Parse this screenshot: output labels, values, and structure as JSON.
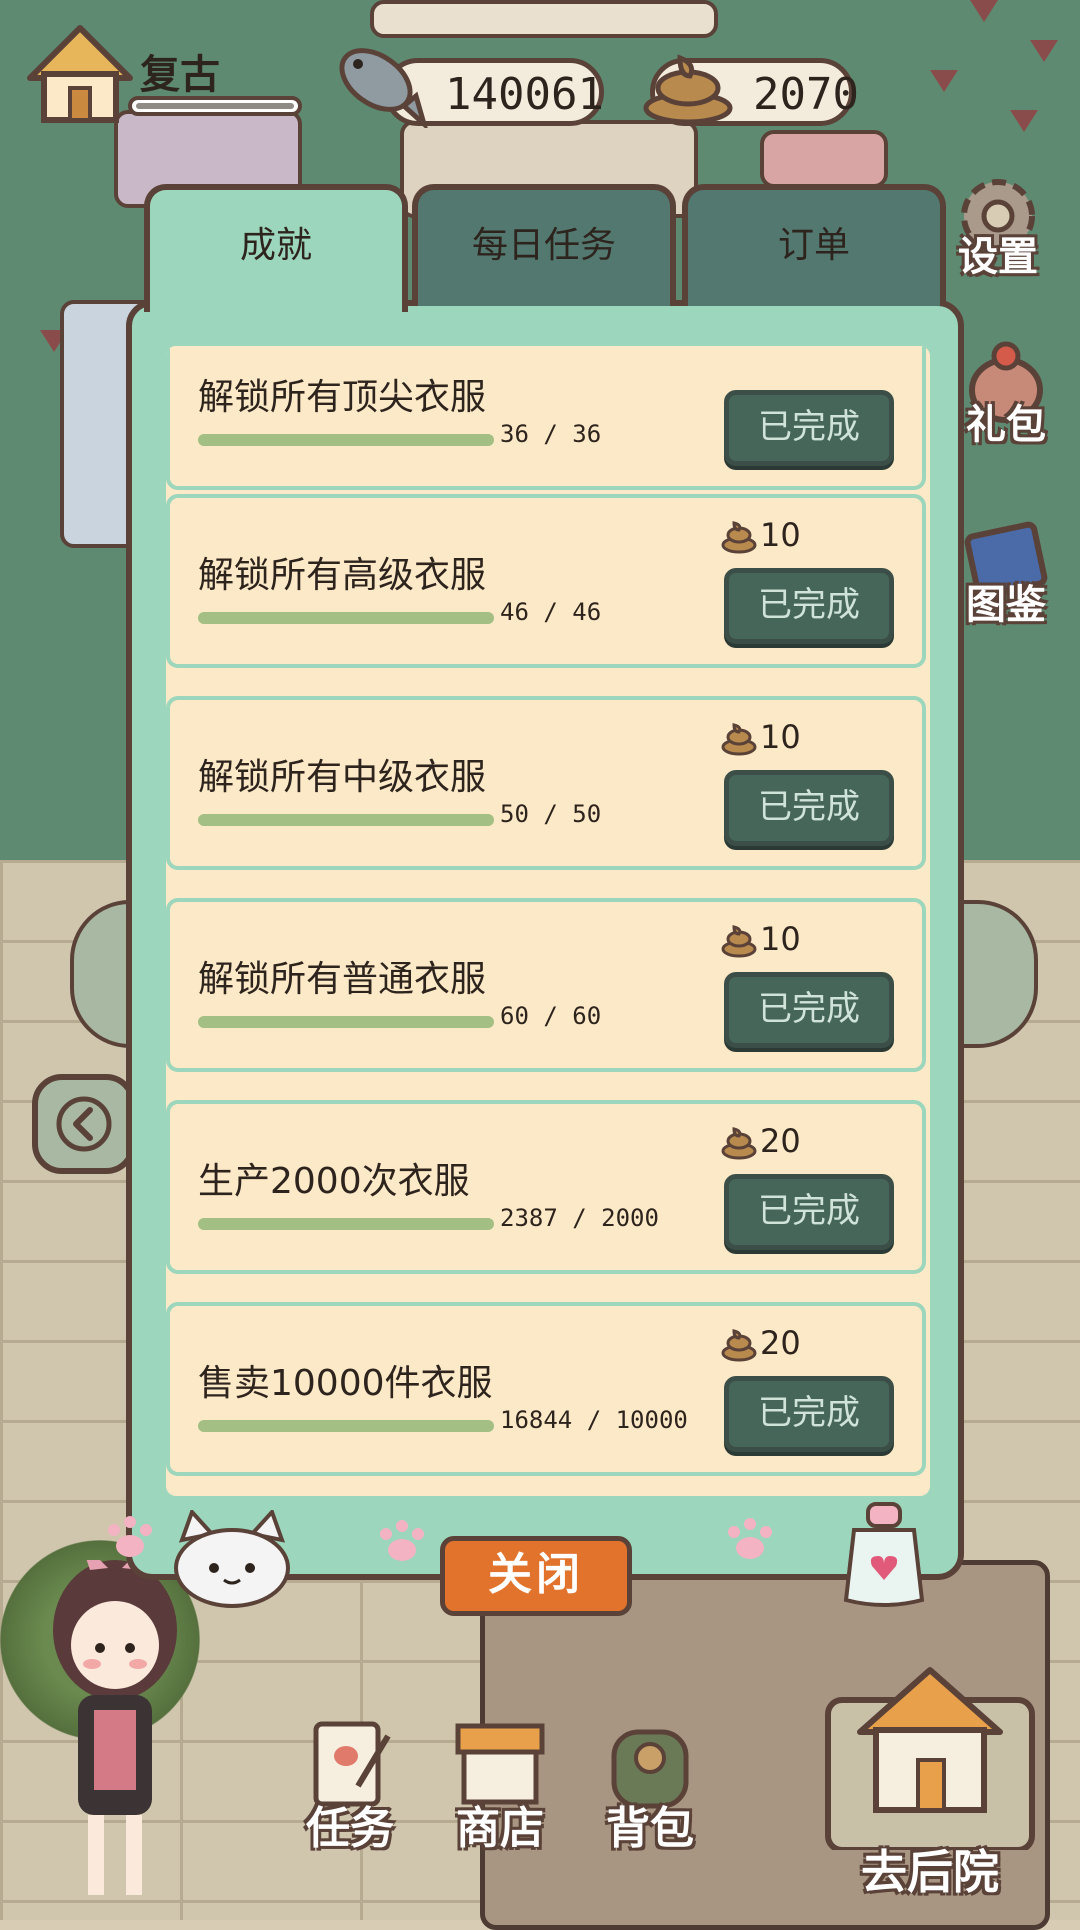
{
  "hud": {
    "player_name": "复古",
    "fish_amount": "140061",
    "poo_amount": "2070"
  },
  "tabs": [
    {
      "label": "成就",
      "active": true
    },
    {
      "label": "每日任务",
      "active": false
    },
    {
      "label": "订单",
      "active": false
    }
  ],
  "achievements": [
    {
      "title": "解锁所有顶尖衣服",
      "progress": "36 / 36",
      "reward": "",
      "button": "已完成"
    },
    {
      "title": "解锁所有高级衣服",
      "progress": "46 / 46",
      "reward": "10",
      "button": "已完成"
    },
    {
      "title": "解锁所有中级衣服",
      "progress": "50 / 50",
      "reward": "10",
      "button": "已完成"
    },
    {
      "title": "解锁所有普通衣服",
      "progress": "60 / 60",
      "reward": "10",
      "button": "已完成"
    },
    {
      "title": "生产2000次衣服",
      "progress": "2387 / 2000",
      "reward": "20",
      "button": "已完成"
    },
    {
      "title": "售卖10000件衣服",
      "progress": "16844 / 10000",
      "reward": "20",
      "button": "已完成"
    }
  ],
  "close_label": "关闭",
  "side_buttons": {
    "settings": "设置",
    "gift": "礼包",
    "catalog": "图鉴"
  },
  "bottom_nav": {
    "tasks": "任务",
    "shop": "商店",
    "bag": "背包",
    "backyard": "去后院"
  },
  "colors": {
    "panel": "#9cd6bc",
    "card": "#fce9c7",
    "done_button": "#47665a",
    "close_button": "#e2732d",
    "progress_fill": "#a4bf84"
  }
}
